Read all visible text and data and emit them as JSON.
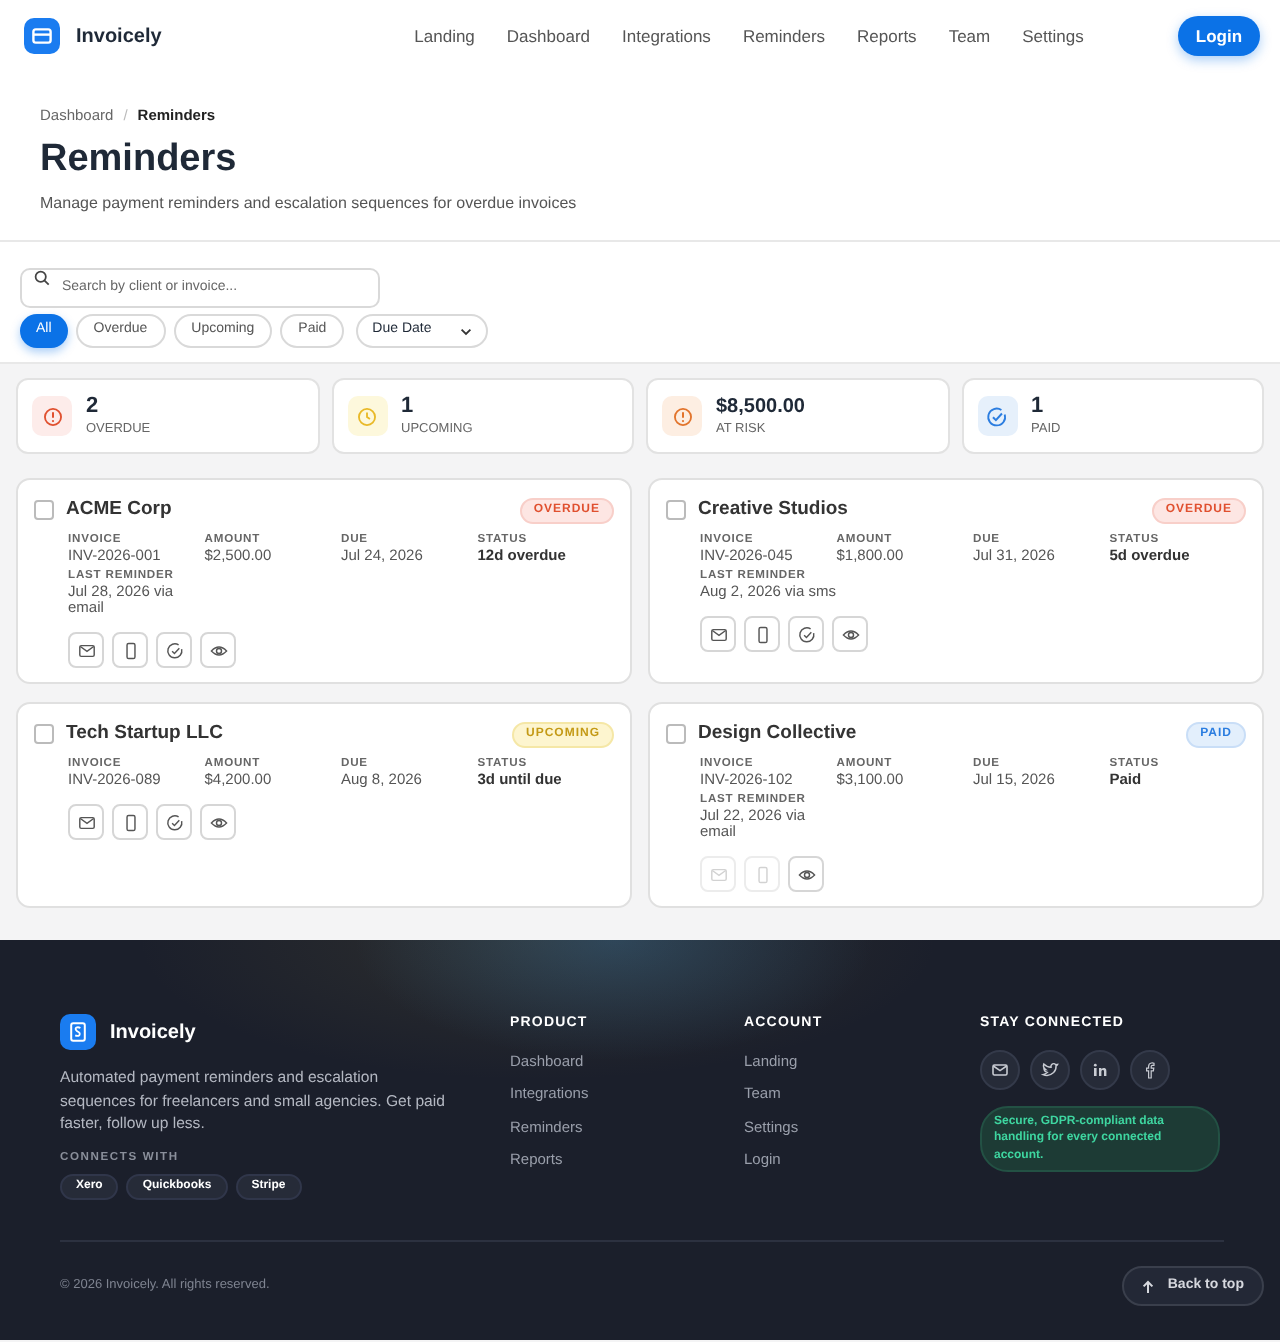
{
  "brand": {
    "name": "Invoicely"
  },
  "nav": [
    {
      "label": "Landing"
    },
    {
      "label": "Dashboard"
    },
    {
      "label": "Integrations"
    },
    {
      "label": "Reminders"
    },
    {
      "label": "Reports"
    },
    {
      "label": "Team"
    },
    {
      "label": "Settings"
    }
  ],
  "login_button": "Login",
  "breadcrumb": {
    "separator": "/",
    "items": [
      {
        "label": "Dashboard",
        "selected": false
      },
      {
        "label": "Reminders",
        "selected": true
      }
    ]
  },
  "page": {
    "title": "Reminders",
    "subtitle": "Manage payment reminders and escalation sequences for overdue invoices"
  },
  "search": {
    "placeholder": "Search by client or invoice..."
  },
  "filters": [
    {
      "label": "All",
      "selected": true
    },
    {
      "label": "Overdue",
      "selected": false
    },
    {
      "label": "Upcoming",
      "selected": false
    },
    {
      "label": "Paid",
      "selected": false
    }
  ],
  "sort": {
    "value": "Due Date"
  },
  "stats": [
    {
      "kind": "overdue",
      "value": "2",
      "label": "OVERDUE"
    },
    {
      "kind": "upcoming",
      "value": "1",
      "label": "UPCOMING"
    },
    {
      "kind": "risk",
      "value": "$8,500.00",
      "label": "AT RISK"
    },
    {
      "kind": "paid",
      "value": "1",
      "label": "PAID"
    }
  ],
  "reminders": [
    {
      "client": "ACME Corp",
      "checked": false,
      "badge": "OVERDUE",
      "kind": "overdue",
      "fields": [
        {
          "kind": "plain",
          "label": "INVOICE",
          "value": "INV-2026-001"
        },
        {
          "kind": "plain",
          "label": "AMOUNT",
          "value": "$2,500.00"
        },
        {
          "kind": "plain",
          "label": "DUE",
          "value": "Jul 24, 2026"
        },
        {
          "kind": "emphasis",
          "label": "STATUS",
          "value": "12d overdue"
        },
        {
          "kind": "plain",
          "label": "LAST REMINDER",
          "value": "Jul 28, 2026 via email"
        }
      ],
      "actions": [
        {
          "kind": "email",
          "disabled": false
        },
        {
          "kind": "sms",
          "disabled": false
        },
        {
          "kind": "mark-paid",
          "disabled": false
        },
        {
          "kind": "view",
          "disabled": false
        }
      ]
    },
    {
      "client": "Creative Studios",
      "checked": false,
      "badge": "OVERDUE",
      "kind": "overdue",
      "fields": [
        {
          "kind": "plain",
          "label": "INVOICE",
          "value": "INV-2026-045"
        },
        {
          "kind": "plain",
          "label": "AMOUNT",
          "value": "$1,800.00"
        },
        {
          "kind": "plain",
          "label": "DUE",
          "value": "Jul 31, 2026"
        },
        {
          "kind": "emphasis",
          "label": "STATUS",
          "value": "5d overdue"
        },
        {
          "kind": "plain",
          "label": "LAST REMINDER",
          "value": "Aug 2, 2026 via sms"
        }
      ],
      "actions": [
        {
          "kind": "email",
          "disabled": false
        },
        {
          "kind": "sms",
          "disabled": false
        },
        {
          "kind": "mark-paid",
          "disabled": false
        },
        {
          "kind": "view",
          "disabled": false
        }
      ]
    },
    {
      "client": "Tech Startup LLC",
      "checked": false,
      "badge": "UPCOMING",
      "kind": "upcoming",
      "fields": [
        {
          "kind": "plain",
          "label": "INVOICE",
          "value": "INV-2026-089"
        },
        {
          "kind": "plain",
          "label": "AMOUNT",
          "value": "$4,200.00"
        },
        {
          "kind": "plain",
          "label": "DUE",
          "value": "Aug 8, 2026"
        },
        {
          "kind": "emphasis",
          "label": "STATUS",
          "value": "3d until due"
        }
      ],
      "actions": [
        {
          "kind": "email",
          "disabled": false
        },
        {
          "kind": "sms",
          "disabled": false
        },
        {
          "kind": "mark-paid",
          "disabled": false
        },
        {
          "kind": "view",
          "disabled": false
        }
      ]
    },
    {
      "client": "Design Collective",
      "checked": false,
      "badge": "PAID",
      "kind": "paid",
      "fields": [
        {
          "kind": "plain",
          "label": "INVOICE",
          "value": "INV-2026-102"
        },
        {
          "kind": "plain",
          "label": "AMOUNT",
          "value": "$3,100.00"
        },
        {
          "kind": "plain",
          "label": "DUE",
          "value": "Jul 15, 2026"
        },
        {
          "kind": "emphasis",
          "label": "STATUS",
          "value": "Paid"
        },
        {
          "kind": "plain",
          "label": "LAST REMINDER",
          "value": "Jul 22, 2026 via email"
        }
      ],
      "actions": [
        {
          "kind": "email",
          "disabled": true
        },
        {
          "kind": "sms",
          "disabled": true
        },
        {
          "kind": "view",
          "disabled": false
        }
      ]
    }
  ],
  "footer": {
    "brand": "Invoicely",
    "description": "Automated payment reminders and escalation sequences for freelancers and small agencies. Get paid faster, follow up less.",
    "connects_label": "CONNECTS WITH",
    "integrations": [
      "Xero",
      "Quickbooks",
      "Stripe"
    ],
    "columns": [
      {
        "heading": "PRODUCT",
        "links": [
          "Dashboard",
          "Integrations",
          "Reminders",
          "Reports"
        ]
      },
      {
        "heading": "ACCOUNT",
        "links": [
          "Landing",
          "Team",
          "Settings",
          "Login"
        ]
      }
    ],
    "social_heading": "STAY CONNECTED",
    "social": [
      {
        "kind": "email"
      },
      {
        "kind": "twitter"
      },
      {
        "kind": "linkedin"
      },
      {
        "kind": "facebook"
      }
    ],
    "security_note": "Secure, GDPR-compliant data handling for every connected account.",
    "copyright": "© 2026 Invoicely. All rights reserved.",
    "back_to_top": "Back to top"
  }
}
